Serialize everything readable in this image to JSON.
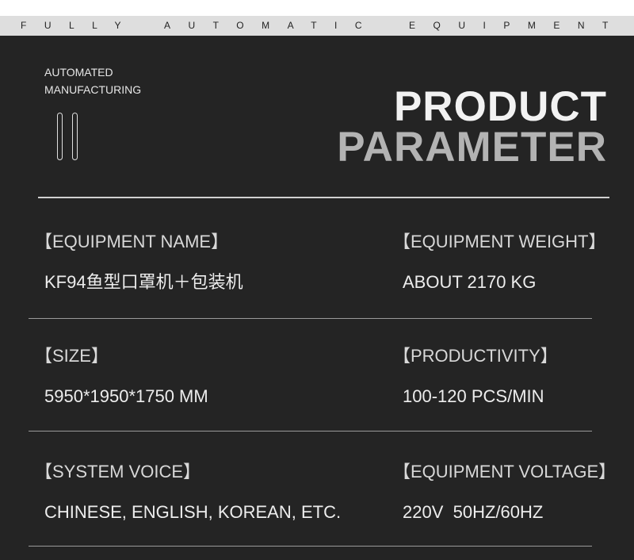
{
  "tagline": {
    "part1": "FULLY",
    "part2": "AUTOMATIC",
    "part3": "EQUIPMENT"
  },
  "brand": {
    "line1": "AUTOMATED",
    "line2": "MANUFACTURING"
  },
  "title": {
    "line1": "PRODUCT",
    "line2": "PARAMETER"
  },
  "params": [
    {
      "label": "【EQUIPMENT NAME】",
      "value": "KF94鱼型口罩机＋包装机"
    },
    {
      "label": "【EQUIPMENT WEIGHT】",
      "value": "ABOUT 2170 KG"
    },
    {
      "label": "【SIZE】",
      "value": "5950*1950*1750 MM"
    },
    {
      "label": "【PRODUCTIVITY】",
      "value": "100-120 PCS/MIN"
    },
    {
      "label": "【SYSTEM VOICE】",
      "value": "CHINESE, ENGLISH, KOREAN, ETC."
    },
    {
      "label": "【EQUIPMENT VOLTAGE】",
      "value": "220V  50HZ/60HZ"
    }
  ]
}
